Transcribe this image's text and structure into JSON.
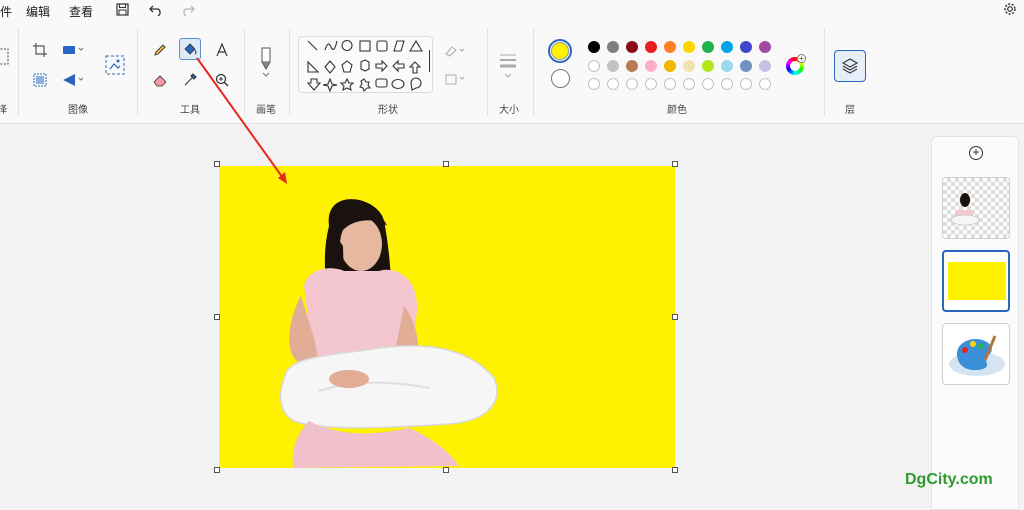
{
  "menu": {
    "cut_off_label": "件",
    "edit": "编辑",
    "view": "查看"
  },
  "ribbon": {
    "groups": {
      "selection_cut": "择",
      "image": "图像",
      "tools": "工具",
      "brushes": "画笔",
      "shapes": "形状",
      "size": "大小",
      "colors": "颜色",
      "layers": "层"
    },
    "tools": [
      "pencil",
      "fill",
      "text",
      "eraser",
      "color-picker",
      "magnifier"
    ],
    "active_tool": "fill"
  },
  "colors": {
    "primary": "#fff200",
    "secondary": "#ffffff",
    "palette_row1": [
      "#000000",
      "#7f7f7f",
      "#8b0a14",
      "#e81c24",
      "#ff7f27",
      "#ffd700",
      "#22b14c",
      "#00a2e8",
      "#3f48cc",
      "#a349a4"
    ],
    "palette_row2": [
      "#ffffff",
      "#c3c3c3",
      "#b97a57",
      "#ffaec9",
      "#f2b600",
      "#efe4b0",
      "#b5e61d",
      "#99d9ea",
      "#7092be",
      "#c8bfe7"
    ],
    "palette_row3_count": 10
  },
  "canvas": {
    "background": "#fff200"
  },
  "layers_panel": {
    "add_button": "+",
    "layers": [
      "photo-transparent",
      "yellow-fill",
      "paint-app-icon"
    ],
    "selected_index": 1
  },
  "watermark": "DgCity.com"
}
